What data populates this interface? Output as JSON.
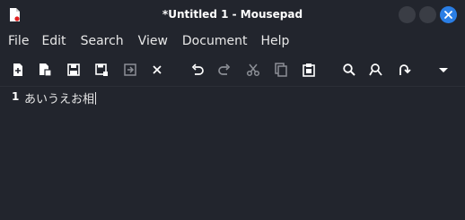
{
  "window": {
    "title": "*Untitled 1 - Mousepad",
    "accent": "#2a7ee5"
  },
  "menu": [
    "File",
    "Edit",
    "Search",
    "View",
    "Document",
    "Help"
  ],
  "toolbar": {
    "buttons": [
      "new-document-icon",
      "new-window-icon",
      "save-icon",
      "save-as-icon",
      "revert-icon",
      "close-tab-icon",
      "undo-icon",
      "redo-icon",
      "cut-icon",
      "copy-icon",
      "paste-icon",
      "find-icon",
      "find-replace-icon",
      "go-to-line-icon",
      "overflow-menu-icon"
    ]
  },
  "editor": {
    "line_number": "1",
    "line_text": "あいうえお相"
  }
}
